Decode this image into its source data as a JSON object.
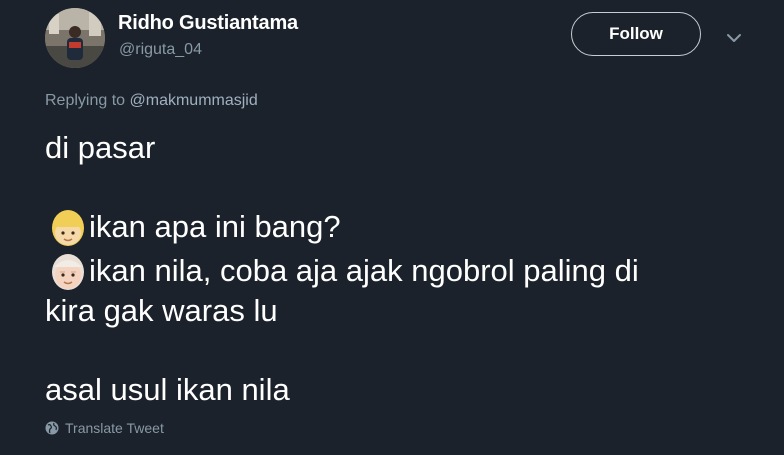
{
  "author": {
    "display_name": "Ridho Gustiantama",
    "handle": "@riguta_04",
    "avatar_icon": "user-photo"
  },
  "follow_label": "Follow",
  "menu_icon": "chevron-down-icon",
  "reply": {
    "prefix": "Replying to ",
    "mention": "@makmummasjid"
  },
  "tweet": {
    "line1": "di pasar",
    "line2": "ikan apa ini bang?",
    "line3": "ikan nila, coba aja ajak ngobrol paling di",
    "line4": "kira gak waras lu",
    "line5": "asal usul ikan nila",
    "emoji1": "blond-person-emoji",
    "emoji2": "older-person-emoji"
  },
  "translate_label": "Translate Tweet",
  "colors": {
    "background": "#1b222b",
    "text": "#ffffff",
    "muted": "#8899a6",
    "button_border": "#c7cdd2"
  }
}
